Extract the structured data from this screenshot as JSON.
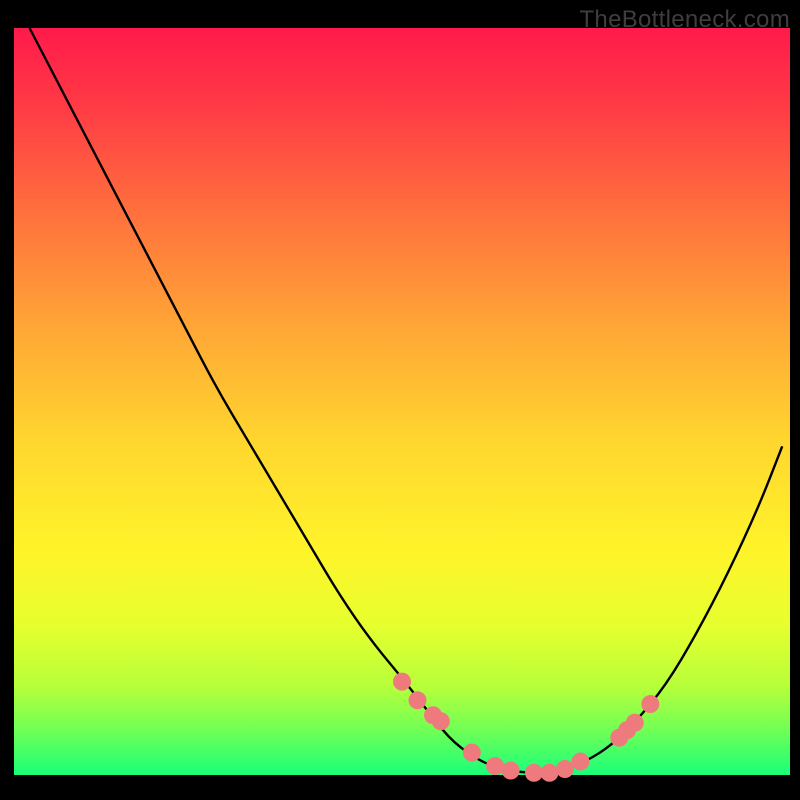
{
  "watermark": "TheBottleneck.com",
  "plot": {
    "x_range": [
      14,
      790
    ],
    "y_range": [
      28,
      775
    ],
    "gradient_stops": [
      {
        "offset": 0.0,
        "color": "#ff1a4b"
      },
      {
        "offset": 0.1,
        "color": "#ff3945"
      },
      {
        "offset": 0.25,
        "color": "#ff713d"
      },
      {
        "offset": 0.4,
        "color": "#ffa636"
      },
      {
        "offset": 0.55,
        "color": "#ffd52f"
      },
      {
        "offset": 0.7,
        "color": "#fff42a"
      },
      {
        "offset": 0.8,
        "color": "#e6ff2e"
      },
      {
        "offset": 0.88,
        "color": "#b8ff3a"
      },
      {
        "offset": 0.94,
        "color": "#70ff55"
      },
      {
        "offset": 1.0,
        "color": "#19ff7a"
      }
    ]
  },
  "chart_data": {
    "type": "line",
    "title": "",
    "xlabel": "",
    "ylabel": "",
    "xlim": [
      0,
      100
    ],
    "ylim": [
      0,
      100
    ],
    "series": [
      {
        "name": "curve",
        "x": [
          2,
          6,
          10,
          14,
          18,
          22,
          26,
          30,
          34,
          38,
          42,
          46,
          50,
          53,
          56,
          59,
          62,
          65,
          68,
          71,
          74,
          77,
          80,
          84,
          88,
          92,
          96,
          99
        ],
        "y": [
          100,
          92,
          84,
          76,
          68,
          60,
          52,
          45,
          38,
          31,
          24,
          18,
          13,
          9,
          5,
          2.5,
          1,
          0.4,
          0.2,
          0.7,
          2,
          4,
          7,
          12,
          19,
          27,
          36,
          44
        ]
      }
    ],
    "markers": {
      "name": "highlight-dots",
      "color": "#ef7a7e",
      "x": [
        50,
        52,
        54,
        55,
        59,
        62,
        64,
        67,
        69,
        71,
        73,
        78,
        79,
        80,
        82
      ],
      "y": [
        12.5,
        10,
        8,
        7.2,
        3,
        1.2,
        0.6,
        0.3,
        0.3,
        0.8,
        1.8,
        5,
        6,
        7,
        9.5
      ]
    }
  }
}
